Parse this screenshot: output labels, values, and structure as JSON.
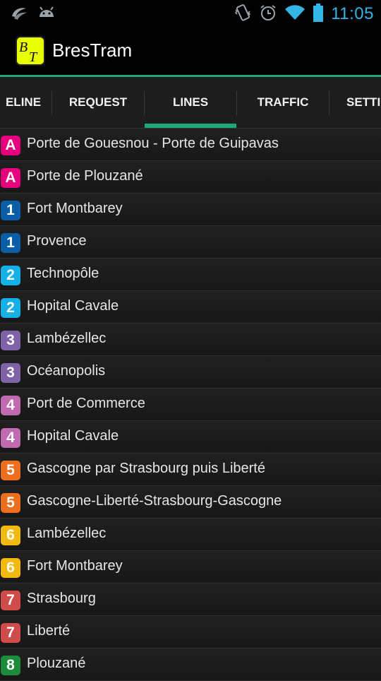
{
  "status_bar": {
    "time": "11:05",
    "left_icons": [
      "swiftkey-icon",
      "android-icon"
    ],
    "right_icons": [
      "vibrate-icon",
      "alarm-icon",
      "wifi-icon",
      "battery-icon"
    ],
    "accent": "#33b5e5"
  },
  "action_bar": {
    "title": "BresTram",
    "logo_text": "BT",
    "logo_color": "#e8ff00"
  },
  "tabs": {
    "items": [
      {
        "label": "ELINE",
        "selected": false
      },
      {
        "label": "REQUEST",
        "selected": false
      },
      {
        "label": "LINES",
        "selected": true
      },
      {
        "label": "TRAFFIC",
        "selected": false
      },
      {
        "label": "SETTI",
        "selected": false
      }
    ],
    "indicator_color": "#1fa67a"
  },
  "lines": [
    {
      "code": "A",
      "color": "#e6007e",
      "label": "Porte de Gouesnou - Porte de Guipavas"
    },
    {
      "code": "A",
      "color": "#e6007e",
      "label": "Porte de Plouzané"
    },
    {
      "code": "1",
      "color": "#0a5ea8",
      "label": "Fort Montbarey"
    },
    {
      "code": "1",
      "color": "#0a5ea8",
      "label": "Provence"
    },
    {
      "code": "2",
      "color": "#14b0e6",
      "label": "Technopôle"
    },
    {
      "code": "2",
      "color": "#14b0e6",
      "label": "Hopital Cavale"
    },
    {
      "code": "3",
      "color": "#7e63a9",
      "label": "Lambézellec"
    },
    {
      "code": "3",
      "color": "#7e63a9",
      "label": "Océanopolis"
    },
    {
      "code": "4",
      "color": "#c06ab0",
      "label": "Port de Commerce"
    },
    {
      "code": "4",
      "color": "#c06ab0",
      "label": "Hopital Cavale"
    },
    {
      "code": "5",
      "color": "#ec6f1e",
      "label": "Gascogne par Strasbourg puis Liberté"
    },
    {
      "code": "5",
      "color": "#ec6f1e",
      "label": "Gascogne-Liberté-Strasbourg-Gascogne"
    },
    {
      "code": "6",
      "color": "#f2b90f",
      "label": "Lambézellec"
    },
    {
      "code": "6",
      "color": "#f2b90f",
      "label": "Fort Montbarey"
    },
    {
      "code": "7",
      "color": "#cf4c4a",
      "label": "Strasbourg"
    },
    {
      "code": "7",
      "color": "#cf4c4a",
      "label": "Liberté"
    },
    {
      "code": "8",
      "color": "#1e8a3c",
      "label": "Plouzané"
    }
  ]
}
